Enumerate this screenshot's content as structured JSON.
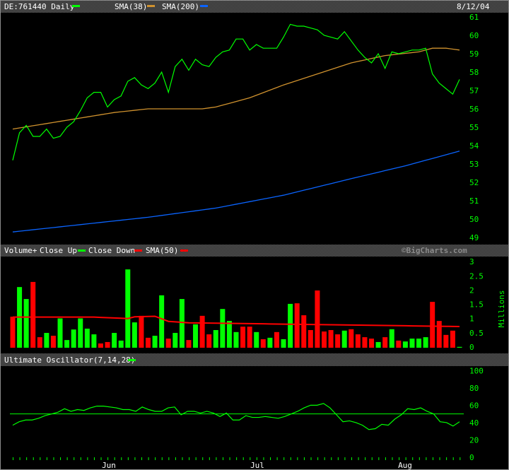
{
  "colors": {
    "price": "#00ff00",
    "sma38": "#d0922e",
    "sma200": "#0a64ff",
    "up": "#00ff00",
    "down": "#ff0000",
    "vol_sma": "#ff0000",
    "osc": "#00ff00"
  },
  "chart_data": [
    {
      "type": "line",
      "title": "DE:761440 Daily",
      "date": "8/12/04",
      "legend": [
        "DE:761440 Daily",
        "SMA(38)",
        "SMA(200)"
      ],
      "ylim": [
        49,
        61
      ],
      "yticks": [
        "61",
        "60",
        "59",
        "58",
        "57",
        "56",
        "55",
        "54",
        "53",
        "52",
        "51",
        "50",
        "49"
      ],
      "price": [
        53.2,
        54.7,
        55.1,
        54.5,
        54.5,
        54.9,
        54.4,
        54.5,
        55.0,
        55.3,
        55.9,
        56.6,
        56.9,
        56.9,
        56.1,
        56.5,
        56.7,
        57.5,
        57.7,
        57.3,
        57.1,
        57.4,
        58.0,
        56.9,
        58.3,
        58.7,
        58.1,
        58.7,
        58.4,
        58.3,
        58.8,
        59.1,
        59.2,
        59.8,
        59.8,
        59.2,
        59.5,
        59.3,
        59.3,
        59.3,
        59.9,
        60.6,
        60.5,
        60.5,
        60.4,
        60.3,
        60.0,
        59.9,
        59.8,
        60.2,
        59.7,
        59.2,
        58.8,
        58.5,
        59.0,
        58.2,
        59.1,
        59.0,
        59.1,
        59.2,
        59.2,
        59.3,
        57.9,
        57.4,
        57.1,
        56.8,
        57.6
      ],
      "sma38": [
        [
          0,
          54.9
        ],
        [
          5,
          55.2
        ],
        [
          10,
          55.5
        ],
        [
          15,
          55.8
        ],
        [
          20,
          56.0
        ],
        [
          28,
          56.0
        ],
        [
          30,
          56.1
        ],
        [
          35,
          56.6
        ],
        [
          40,
          57.3
        ],
        [
          45,
          57.9
        ],
        [
          50,
          58.5
        ],
        [
          55,
          58.9
        ],
        [
          60,
          59.1
        ],
        [
          62,
          59.3
        ],
        [
          64,
          59.3
        ],
        [
          66,
          59.2
        ]
      ],
      "sma200": [
        [
          0,
          49.3
        ],
        [
          10,
          49.7
        ],
        [
          20,
          50.1
        ],
        [
          30,
          50.6
        ],
        [
          40,
          51.3
        ],
        [
          50,
          52.2
        ],
        [
          58,
          52.9
        ],
        [
          66,
          53.7
        ]
      ]
    },
    {
      "type": "bar",
      "title": "Volume+",
      "legend": [
        "Close Up",
        "Close Down",
        "SMA(50)"
      ],
      "ylabel": "Millions",
      "ylim": [
        0,
        3
      ],
      "yticks": [
        "3",
        "2.5",
        "2",
        "1.5",
        "1",
        "0.5",
        "0"
      ],
      "values": [
        1.09,
        2.13,
        1.71,
        2.31,
        0.37,
        0.52,
        0.42,
        1.03,
        0.27,
        0.64,
        1.03,
        0.67,
        0.47,
        0.15,
        0.2,
        0.52,
        0.25,
        2.75,
        0.89,
        1.12,
        0.35,
        0.42,
        1.84,
        0.32,
        0.52,
        1.71,
        0.27,
        0.82,
        1.12,
        0.47,
        0.62,
        1.36,
        0.94,
        0.55,
        0.74,
        0.74,
        0.55,
        0.3,
        0.35,
        0.55,
        0.3,
        1.54,
        1.56,
        1.14,
        0.62,
        2.01,
        0.57,
        0.62,
        0.47,
        0.6,
        0.65,
        0.47,
        0.37,
        0.32,
        0.2,
        0.37,
        0.65,
        0.25,
        0.22,
        0.32,
        0.32,
        0.37,
        1.61,
        0.94,
        0.45,
        0.6,
        0.03
      ],
      "direction": [
        "d",
        "u",
        "u",
        "d",
        "d",
        "u",
        "d",
        "u",
        "u",
        "u",
        "u",
        "u",
        "u",
        "d",
        "d",
        "u",
        "u",
        "u",
        "u",
        "d",
        "d",
        "u",
        "u",
        "d",
        "u",
        "u",
        "d",
        "u",
        "d",
        "d",
        "u",
        "u",
        "u",
        "u",
        "d",
        "d",
        "u",
        "d",
        "u",
        "d",
        "u",
        "u",
        "d",
        "d",
        "d",
        "d",
        "d",
        "d",
        "d",
        "u",
        "d",
        "d",
        "d",
        "d",
        "u",
        "d",
        "u",
        "d",
        "u",
        "u",
        "u",
        "u",
        "d",
        "d",
        "d",
        "d",
        "u"
      ],
      "sma50": [
        [
          0,
          1.05
        ],
        [
          12,
          1.05
        ],
        [
          15,
          1.02
        ],
        [
          17,
          1.0
        ],
        [
          18,
          1.06
        ],
        [
          21,
          1.08
        ],
        [
          23,
          0.9
        ],
        [
          26,
          0.85
        ],
        [
          66,
          0.72
        ]
      ]
    },
    {
      "type": "line",
      "title": "Ultimate Oscillator(7,14,28)",
      "ylim": [
        0,
        100
      ],
      "yticks": [
        "100",
        "80",
        "60",
        "40",
        "20",
        "0"
      ],
      "reference_line": 50,
      "values": [
        37,
        41,
        43,
        43,
        45,
        48,
        50,
        52,
        56,
        53,
        55,
        54,
        57,
        59,
        59,
        58,
        57,
        55,
        55,
        53,
        58,
        55,
        53,
        53,
        57,
        58,
        49,
        53,
        53,
        51,
        53,
        51,
        47,
        51,
        43,
        43,
        48,
        46,
        46,
        47,
        46,
        45,
        47,
        50,
        53,
        57,
        60,
        60,
        62,
        57,
        49,
        41,
        42,
        40,
        37,
        32,
        33,
        38,
        37,
        44,
        49,
        56,
        55,
        57,
        53,
        50,
        41,
        40,
        36,
        41
      ],
      "xticks": [
        "Jun",
        "Jul",
        "Aug"
      ]
    }
  ],
  "watermark": "©BigCharts.com"
}
